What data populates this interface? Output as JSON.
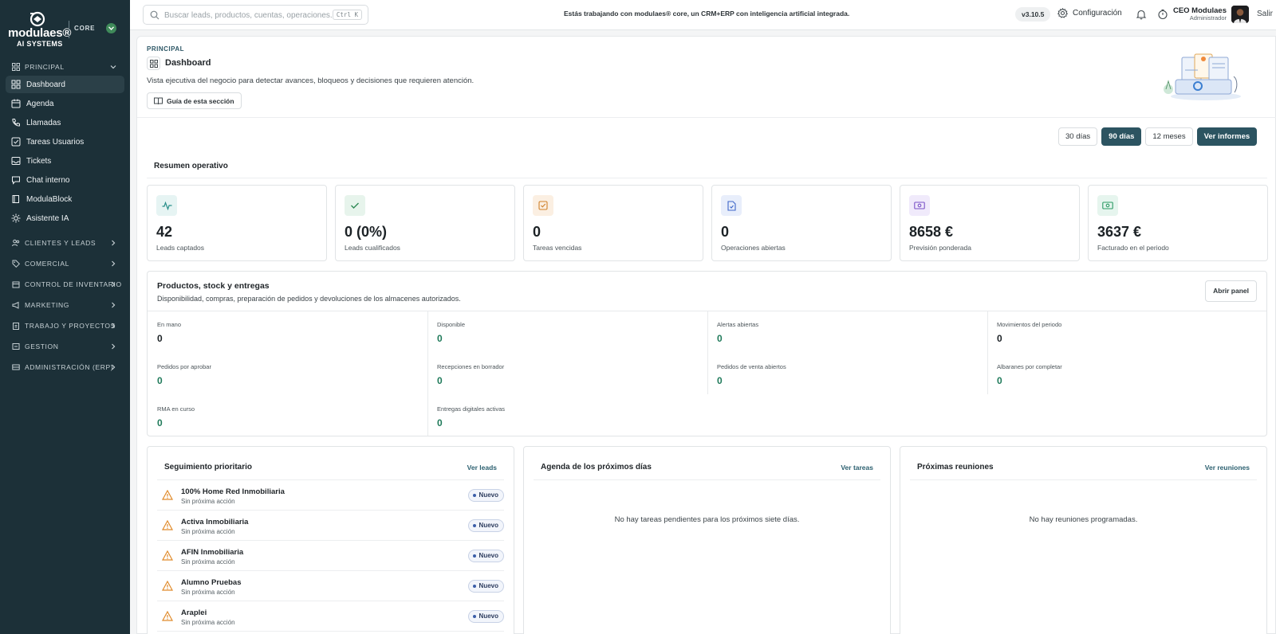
{
  "brand": {
    "name": "modulaes®",
    "sub": "AI SYSTEMS",
    "edition": "CORE"
  },
  "sidebar": {
    "groups": [
      {
        "label": "PRINCIPAL",
        "icon": "grid-icon",
        "expanded": true
      },
      {
        "label": "CLIENTES Y LEADS",
        "icon": "users-icon"
      },
      {
        "label": "COMERCIAL",
        "icon": "tag-icon"
      },
      {
        "label": "CONTROL DE INVENTARIO",
        "icon": "box-icon"
      },
      {
        "label": "MARKETING",
        "icon": "megaphone-icon"
      },
      {
        "label": "TRABAJO Y PROYECTOS",
        "icon": "clipboard-icon"
      },
      {
        "label": "GESTION",
        "icon": "folder-icon"
      },
      {
        "label": "ADMINISTRACIÓN (ERP)",
        "icon": "server-icon"
      }
    ],
    "items": [
      {
        "label": "Dashboard",
        "icon": "grid-icon",
        "active": true
      },
      {
        "label": "Agenda",
        "icon": "calendar-icon"
      },
      {
        "label": "Llamadas",
        "icon": "phone-icon"
      },
      {
        "label": "Tareas Usuarios",
        "icon": "checkbox-icon"
      },
      {
        "label": "Tickets",
        "icon": "inbox-icon"
      },
      {
        "label": "Chat interno",
        "icon": "chat-icon"
      },
      {
        "label": "ModulaBlock",
        "icon": "book-icon"
      },
      {
        "label": "Asistente IA",
        "icon": "sparkle-icon"
      }
    ]
  },
  "topbar": {
    "search_placeholder": "Buscar leads, productos, cuentas, operaciones...",
    "shortcut": "Ctrl K",
    "banner": "Estás trabajando con modulaes® core, un CRM+ERP con inteligencia artificial integrada.",
    "version": "v3.10.5",
    "config_label": "Configuración",
    "user_name": "CEO Modulaes",
    "user_role": "Administrador",
    "logout": "Salir"
  },
  "page": {
    "kicker": "PRINCIPAL",
    "title": "Dashboard",
    "description": "Vista ejecutiva del negocio para detectar avances, bloqueos y decisiones que requieren atención.",
    "guide_button": "Guía de esta sección"
  },
  "ranges": {
    "d30": "30 días",
    "d90": "90 días",
    "m12": "12 meses",
    "selected": "90 días",
    "reports": "Ver informes"
  },
  "summary": {
    "title": "Resumen operativo",
    "kpis": [
      {
        "value": "42",
        "label": "Leads captados",
        "icon": "activity-icon",
        "color": "#2a8f8a",
        "bg": "#e6f4f3"
      },
      {
        "value": "0 (0%)",
        "label": "Leads cualificados",
        "icon": "check-icon",
        "color": "#2f8a55",
        "bg": "#e7f4ec"
      },
      {
        "value": "0",
        "label": "Tareas vencidas",
        "icon": "task-icon",
        "color": "#d0822b",
        "bg": "#fbefe2"
      },
      {
        "value": "0",
        "label": "Operaciones abiertas",
        "icon": "document-icon",
        "color": "#3e66c8",
        "bg": "#e8eefb"
      },
      {
        "value": "8658 €",
        "label": "Previsión ponderada",
        "icon": "money-icon",
        "color": "#7a52c7",
        "bg": "#f0eafb"
      },
      {
        "value": "3637 €",
        "label": "Facturado en el periodo",
        "icon": "cash-icon",
        "color": "#2a9a63",
        "bg": "#e6f5ee"
      }
    ]
  },
  "stock": {
    "title": "Productos, stock y entregas",
    "description": "Disponibilidad, compras, preparación de pedidos y devoluciones de los almacenes autorizados.",
    "button": "Abrir panel",
    "metrics": [
      {
        "label": "En mano",
        "value": "0"
      },
      {
        "label": "Disponible",
        "value": "0"
      },
      {
        "label": "Alertas abiertas",
        "value": "0"
      },
      {
        "label": "Movimientos del periodo",
        "value": "0"
      },
      {
        "label": "Pedidos por aprobar",
        "value": "0"
      },
      {
        "label": "Recepciones en borrador",
        "value": "0"
      },
      {
        "label": "Pedidos de venta abiertos",
        "value": "0"
      },
      {
        "label": "Albaranes por completar",
        "value": "0"
      },
      {
        "label": "RMA en curso",
        "value": "0"
      },
      {
        "label": "Entregas digitales activas",
        "value": "0"
      }
    ]
  },
  "followup": {
    "title": "Seguimiento prioritario",
    "link": "Ver leads",
    "leads": [
      {
        "name": "100% Home Red Inmobiliaria",
        "sub": "Sin próxima acción",
        "badge": "Nuevo"
      },
      {
        "name": "Activa Inmobiliaria",
        "sub": "Sin próxima acción",
        "badge": "Nuevo"
      },
      {
        "name": "AFIN Inmobiliaria",
        "sub": "Sin próxima acción",
        "badge": "Nuevo"
      },
      {
        "name": "Alumno Pruebas",
        "sub": "Sin próxima acción",
        "badge": "Nuevo"
      },
      {
        "name": "Araplei",
        "sub": "Sin próxima acción",
        "badge": "Nuevo"
      }
    ]
  },
  "agenda": {
    "title": "Agenda de los próximos días",
    "link": "Ver tareas",
    "empty": "No hay tareas pendientes para los próximos siete días."
  },
  "meetings": {
    "title": "Próximas reuniones",
    "link": "Ver reuniones",
    "empty": "No hay reuniones programadas."
  },
  "colors": {
    "sidebar": "#1c3038",
    "accent": "#2c5461",
    "warning": "#e08a2a"
  }
}
